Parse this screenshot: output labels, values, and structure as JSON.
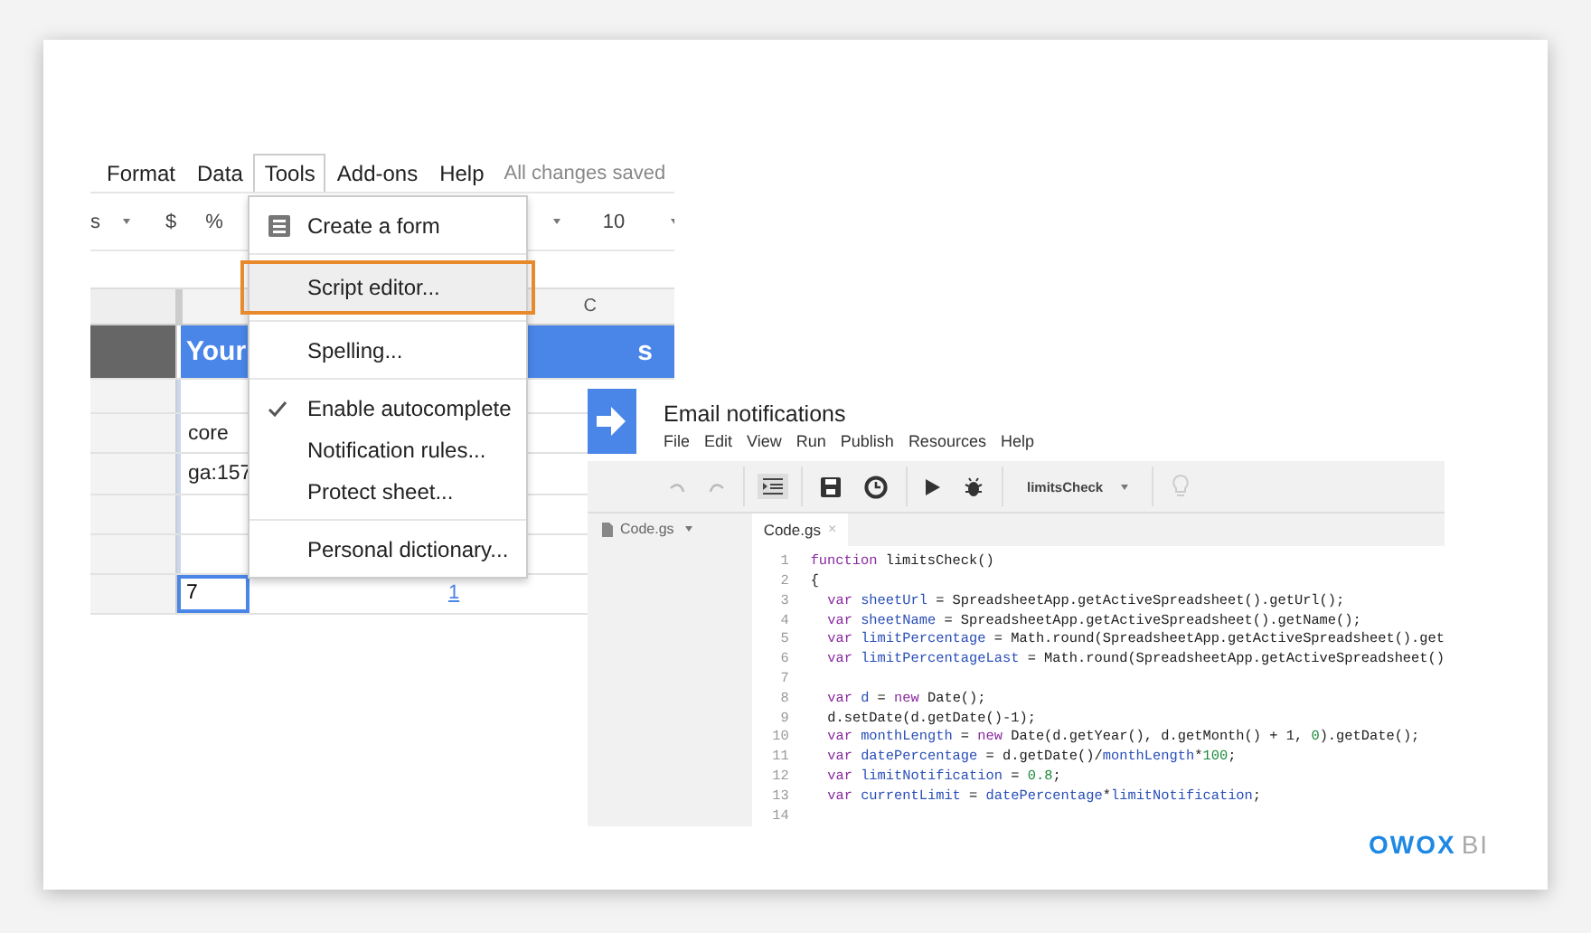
{
  "sheet": {
    "menubar": [
      {
        "label": "Format",
        "selected": false
      },
      {
        "label": "Data",
        "selected": false
      },
      {
        "label": "Tools",
        "selected": true
      },
      {
        "label": "Add-ons",
        "selected": false
      },
      {
        "label": "Help",
        "selected": false
      }
    ],
    "save_status": "All changes saved",
    "toolbar": {
      "format_partial": "s",
      "currency": "$",
      "percent": "%",
      "font_size": "10"
    },
    "column_header": "C",
    "banner_left": "Your",
    "banner_right": "s",
    "cells": [
      {
        "text": ""
      },
      {
        "text": "core"
      },
      {
        "text": "ga:157"
      },
      {
        "text": ""
      },
      {
        "text": ""
      }
    ],
    "selected_cell": "7",
    "link_cell": "1"
  },
  "tools_menu": {
    "items": [
      {
        "kind": "item",
        "label": "Create a form",
        "icon": true,
        "checked": false,
        "highlighted": false
      },
      {
        "kind": "separator"
      },
      {
        "kind": "item",
        "label": "Script editor...",
        "icon": false,
        "checked": false,
        "highlighted": true
      },
      {
        "kind": "separator"
      },
      {
        "kind": "item",
        "label": "Spelling...",
        "icon": false,
        "checked": false,
        "highlighted": false
      },
      {
        "kind": "separator"
      },
      {
        "kind": "item",
        "label": "Enable autocomplete",
        "icon": false,
        "checked": true,
        "highlighted": false
      },
      {
        "kind": "item",
        "label": "Notification rules...",
        "icon": false,
        "checked": false,
        "highlighted": false
      },
      {
        "kind": "item",
        "label": "Protect sheet...",
        "icon": false,
        "checked": false,
        "highlighted": false
      },
      {
        "kind": "separator"
      },
      {
        "kind": "item",
        "label": "Personal dictionary...",
        "icon": false,
        "checked": false,
        "highlighted": false
      }
    ]
  },
  "editor": {
    "title": "Email notifications",
    "menubar": [
      "File",
      "Edit",
      "View",
      "Run",
      "Publish",
      "Resources",
      "Help"
    ],
    "function_select": "limitsCheck",
    "file_list": [
      "Code.gs"
    ],
    "tab": "Code.gs",
    "tab_close": "×",
    "lines": [
      {
        "number": "1",
        "indented": false,
        "tokens": [
          {
            "kind": "keyword",
            "text": "function"
          },
          {
            "kind": "plain",
            "text": " limitsCheck()"
          }
        ]
      },
      {
        "number": "2",
        "indented": false,
        "tokens": [
          {
            "kind": "plain",
            "text": "{"
          }
        ]
      },
      {
        "number": "3",
        "indented": true,
        "tokens": [
          {
            "kind": "keyword",
            "text": "var "
          },
          {
            "kind": "variable",
            "text": "sheetUrl"
          },
          {
            "kind": "plain",
            "text": " = SpreadsheetApp.getActiveSpreadsheet().getUrl();"
          }
        ]
      },
      {
        "number": "4",
        "indented": true,
        "tokens": [
          {
            "kind": "keyword",
            "text": "var "
          },
          {
            "kind": "variable",
            "text": "sheetName"
          },
          {
            "kind": "plain",
            "text": " = SpreadsheetApp.getActiveSpreadsheet().getName();"
          }
        ]
      },
      {
        "number": "5",
        "indented": true,
        "tokens": [
          {
            "kind": "keyword",
            "text": "var "
          },
          {
            "kind": "variable",
            "text": "limitPercentage"
          },
          {
            "kind": "plain",
            "text": " = Math.round(SpreadsheetApp.getActiveSpreadsheet().get"
          }
        ]
      },
      {
        "number": "6",
        "indented": true,
        "tokens": [
          {
            "kind": "keyword",
            "text": "var "
          },
          {
            "kind": "variable",
            "text": "limitPercentageLast"
          },
          {
            "kind": "plain",
            "text": " = Math.round(SpreadsheetApp.getActiveSpreadsheet()"
          }
        ]
      },
      {
        "number": "7"
      },
      {
        "number": "8",
        "indented": true,
        "tokens": [
          {
            "kind": "keyword",
            "text": "var "
          },
          {
            "kind": "variable",
            "text": "d"
          },
          {
            "kind": "plain",
            "text": " = "
          },
          {
            "kind": "keyword",
            "text": "new "
          },
          {
            "kind": "plain",
            "text": "Date();"
          }
        ]
      },
      {
        "number": "9",
        "indented": true,
        "tokens": [
          {
            "kind": "plain",
            "text": "d.setDate(d.getDate()-1);"
          }
        ]
      },
      {
        "number": "10",
        "indented": true,
        "tokens": [
          {
            "kind": "keyword",
            "text": "var "
          },
          {
            "kind": "variable",
            "text": "monthLength"
          },
          {
            "kind": "plain",
            "text": " = "
          },
          {
            "kind": "keyword",
            "text": "new "
          },
          {
            "kind": "plain",
            "text": "Date(d.getYear(), d.getMonth() + 1, "
          },
          {
            "kind": "number",
            "text": "0"
          },
          {
            "kind": "plain",
            "text": ").getDate();"
          }
        ]
      },
      {
        "number": "11",
        "indented": true,
        "tokens": [
          {
            "kind": "keyword",
            "text": "var "
          },
          {
            "kind": "variable",
            "text": "datePercentage"
          },
          {
            "kind": "plain",
            "text": " = d.getDate()/"
          },
          {
            "kind": "variable",
            "text": "monthLength"
          },
          {
            "kind": "plain",
            "text": "*"
          },
          {
            "kind": "number",
            "text": "100"
          },
          {
            "kind": "plain",
            "text": ";"
          }
        ]
      },
      {
        "number": "12",
        "indented": true,
        "tokens": [
          {
            "kind": "keyword",
            "text": "var "
          },
          {
            "kind": "variable",
            "text": "limitNotification"
          },
          {
            "kind": "plain",
            "text": " = "
          },
          {
            "kind": "number",
            "text": "0.8"
          },
          {
            "kind": "plain",
            "text": ";"
          }
        ]
      },
      {
        "number": "13",
        "indented": true,
        "tokens": [
          {
            "kind": "keyword",
            "text": "var "
          },
          {
            "kind": "variable",
            "text": "currentLimit"
          },
          {
            "kind": "plain",
            "text": " = "
          },
          {
            "kind": "variable",
            "text": "datePercentage"
          },
          {
            "kind": "plain",
            "text": "*"
          },
          {
            "kind": "variable",
            "text": "limitNotification"
          },
          {
            "kind": "plain",
            "text": ";"
          }
        ]
      },
      {
        "number": "14"
      }
    ]
  },
  "logo": {
    "mark": "OWOX",
    "suffix": "BI"
  }
}
